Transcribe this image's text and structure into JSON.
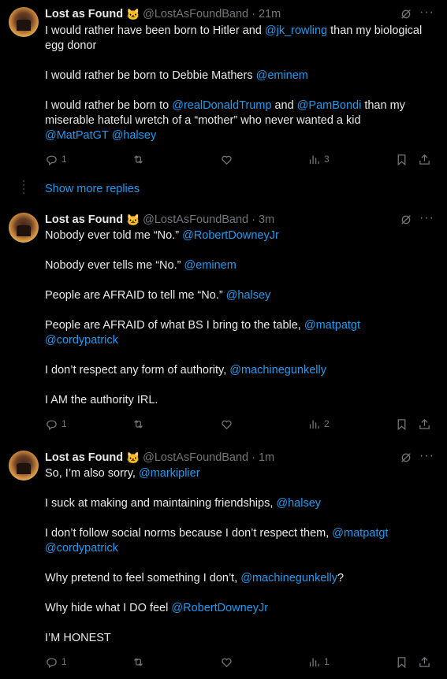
{
  "show_more_replies": "Show more replies",
  "tweets": [
    {
      "name": "Lost as Found",
      "badge": "🐱",
      "handle": "@LostAsFoundBand",
      "time": "· 21m",
      "lines": [
        [
          {
            "t": "I would rather have been born to Hitler and "
          },
          {
            "t": "@jk_rowling",
            "m": true
          },
          {
            "t": " than my biological"
          }
        ],
        [
          {
            "t": "egg donor"
          }
        ],
        [],
        [
          {
            "t": "I would rather be born to Debbie Mathers "
          },
          {
            "t": "@eminem",
            "m": true
          }
        ],
        [],
        [
          {
            "t": "I would rather be born to "
          },
          {
            "t": "@realDonaldTrump",
            "m": true
          },
          {
            "t": " and "
          },
          {
            "t": "@PamBondi",
            "m": true
          },
          {
            "t": " than my"
          }
        ],
        [
          {
            "t": "miserable hateful wretch of a “mother” who never wanted a kid"
          }
        ],
        [
          {
            "t": "@MatPatGT",
            "m": true
          },
          {
            "t": " "
          },
          {
            "t": "@halsey",
            "m": true
          }
        ]
      ],
      "replies": "1",
      "views": "3"
    },
    {
      "name": "Lost as Found",
      "badge": "🐱",
      "handle": "@LostAsFoundBand",
      "time": "· 3m",
      "lines": [
        [
          {
            "t": "Nobody ever told me “No.” "
          },
          {
            "t": "@RobertDowneyJr",
            "m": true
          }
        ],
        [],
        [
          {
            "t": "Nobody ever tells me “No.” "
          },
          {
            "t": "@eminem",
            "m": true
          }
        ],
        [],
        [
          {
            "t": "People are AFRAID to tell me “No.” "
          },
          {
            "t": "@halsey",
            "m": true
          }
        ],
        [],
        [
          {
            "t": "People are AFRAID of what BS I bring to the table, "
          },
          {
            "t": "@matpatgt",
            "m": true
          }
        ],
        [
          {
            "t": "@cordypatrick",
            "m": true
          }
        ],
        [],
        [
          {
            "t": "I don’t respect any form of authority, "
          },
          {
            "t": "@machinegunkelly",
            "m": true
          }
        ],
        [],
        [
          {
            "t": "I AM the authority IRL."
          }
        ]
      ],
      "replies": "1",
      "views": "2"
    },
    {
      "name": "Lost as Found",
      "badge": "🐱",
      "handle": "@LostAsFoundBand",
      "time": "· 1m",
      "lines": [
        [
          {
            "t": "So, I’m also sorry, "
          },
          {
            "t": "@markiplier",
            "m": true
          }
        ],
        [],
        [
          {
            "t": "I suck at making and maintaining friendships, "
          },
          {
            "t": "@halsey",
            "m": true
          }
        ],
        [],
        [
          {
            "t": "I don’t follow social norms because I don’t respect them, "
          },
          {
            "t": "@matpatgt",
            "m": true
          }
        ],
        [
          {
            "t": "@cordypatrick",
            "m": true
          }
        ],
        [],
        [
          {
            "t": "Why pretend to feel something I don’t, "
          },
          {
            "t": "@machinegunkelly",
            "m": true
          },
          {
            "t": "?"
          }
        ],
        [],
        [
          {
            "t": "Why hide what I DO feel "
          },
          {
            "t": "@RobertDowneyJr",
            "m": true
          }
        ],
        [],
        [
          {
            "t": "I’M HONEST"
          }
        ]
      ],
      "replies": "1",
      "views": "1"
    }
  ]
}
